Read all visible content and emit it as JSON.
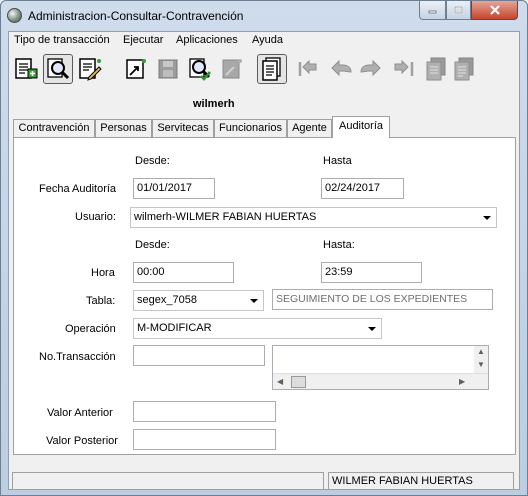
{
  "window": {
    "title": "Administracion-Consultar-Contravención"
  },
  "menu": {
    "items": [
      "Tipo de transacción",
      "Ejecutar",
      "Aplicaciones",
      "Ayuda"
    ]
  },
  "toolbar": {
    "buttons": [
      {
        "icon": "new-record-icon",
        "enabled": true
      },
      {
        "icon": "search-query-icon",
        "enabled": true,
        "active": true
      },
      {
        "icon": "edit-pencil-icon",
        "enabled": true
      },
      {
        "icon": "export-icon",
        "enabled": true
      },
      {
        "icon": "save-disk-icon",
        "enabled": false
      },
      {
        "icon": "execute-check-icon",
        "enabled": true
      },
      {
        "icon": "delete-icon",
        "enabled": false
      },
      {
        "icon": "report-document-icon",
        "enabled": true,
        "active": true
      },
      {
        "icon": "first-record-icon",
        "enabled": false
      },
      {
        "icon": "previous-record-icon",
        "enabled": false
      },
      {
        "icon": "next-record-icon",
        "enabled": false
      },
      {
        "icon": "last-record-icon",
        "enabled": false
      },
      {
        "icon": "copy-document-icon",
        "enabled": false
      },
      {
        "icon": "print-document-icon",
        "enabled": false
      }
    ]
  },
  "user_label": "wilmerh",
  "tabs": [
    "Contravención",
    "Personas",
    "Servitecas",
    "Funcionarios",
    "Agente",
    "Auditoría"
  ],
  "selected_tab": "Auditoría",
  "form": {
    "desde_label": "Desde:",
    "hasta_label": "Hasta",
    "fecha_label": "Fecha Auditoría",
    "fecha_desde": "01/01/2017",
    "fecha_hasta": "02/24/2017",
    "usuario_label": "Usuario:",
    "usuario_value": "wilmerh-WILMER FABIAN HUERTAS",
    "desde_label2": "Desde:",
    "hasta_label2": "Hasta:",
    "hora_label": "Hora",
    "hora_desde": "00:00",
    "hora_hasta": "23:59",
    "tabla_label": "Tabla:",
    "tabla_value": "segex_7058",
    "tabla_descripcion": "SEGUIMIENTO DE LOS EXPEDIENTES",
    "operacion_label": "Operación",
    "operacion_value": "M-MODIFICAR",
    "transaccion_label": "No.Transacción",
    "transaccion_value": "",
    "transaccion_detalle": "",
    "valor_anterior_label": "Valor Anterior",
    "valor_anterior_value": "",
    "valor_posterior_label": "Valor Posterior",
    "valor_posterior_value": ""
  },
  "status": {
    "left": "",
    "right": "WILMER FABIAN HUERTAS"
  }
}
